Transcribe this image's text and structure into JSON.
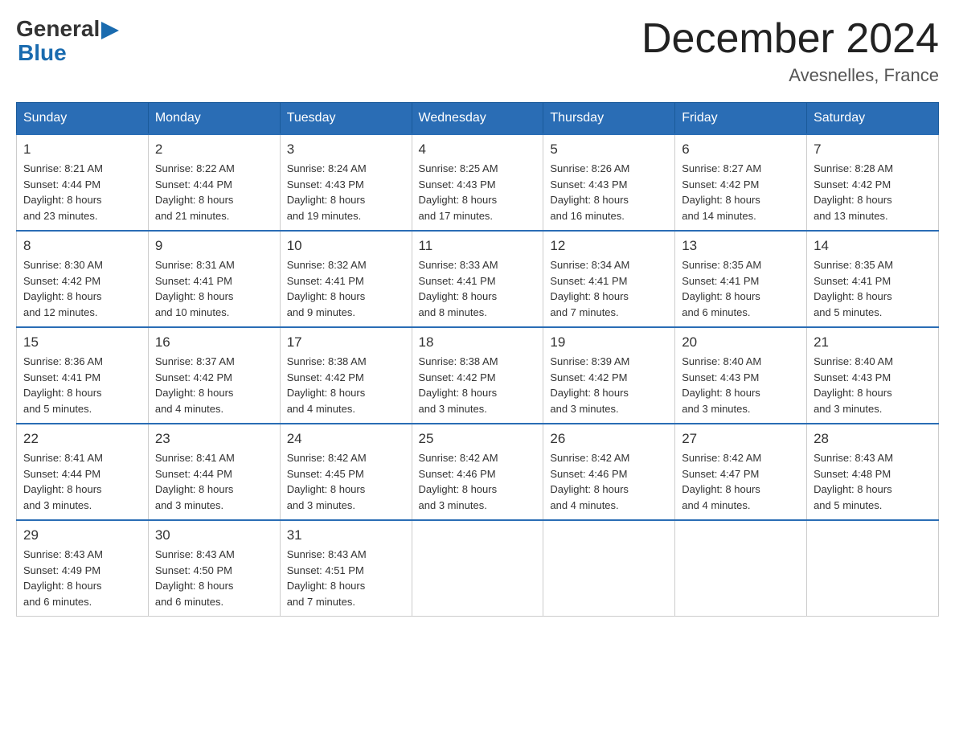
{
  "header": {
    "logo": {
      "general": "General",
      "blue": "Blue",
      "triangle": "▶"
    },
    "title": "December 2024",
    "location": "Avesnelles, France"
  },
  "weekdays": [
    "Sunday",
    "Monday",
    "Tuesday",
    "Wednesday",
    "Thursday",
    "Friday",
    "Saturday"
  ],
  "weeks": [
    [
      {
        "day": "1",
        "sunrise": "Sunrise: 8:21 AM",
        "sunset": "Sunset: 4:44 PM",
        "daylight": "Daylight: 8 hours",
        "minutes": "and 23 minutes."
      },
      {
        "day": "2",
        "sunrise": "Sunrise: 8:22 AM",
        "sunset": "Sunset: 4:44 PM",
        "daylight": "Daylight: 8 hours",
        "minutes": "and 21 minutes."
      },
      {
        "day": "3",
        "sunrise": "Sunrise: 8:24 AM",
        "sunset": "Sunset: 4:43 PM",
        "daylight": "Daylight: 8 hours",
        "minutes": "and 19 minutes."
      },
      {
        "day": "4",
        "sunrise": "Sunrise: 8:25 AM",
        "sunset": "Sunset: 4:43 PM",
        "daylight": "Daylight: 8 hours",
        "minutes": "and 17 minutes."
      },
      {
        "day": "5",
        "sunrise": "Sunrise: 8:26 AM",
        "sunset": "Sunset: 4:43 PM",
        "daylight": "Daylight: 8 hours",
        "minutes": "and 16 minutes."
      },
      {
        "day": "6",
        "sunrise": "Sunrise: 8:27 AM",
        "sunset": "Sunset: 4:42 PM",
        "daylight": "Daylight: 8 hours",
        "minutes": "and 14 minutes."
      },
      {
        "day": "7",
        "sunrise": "Sunrise: 8:28 AM",
        "sunset": "Sunset: 4:42 PM",
        "daylight": "Daylight: 8 hours",
        "minutes": "and 13 minutes."
      }
    ],
    [
      {
        "day": "8",
        "sunrise": "Sunrise: 8:30 AM",
        "sunset": "Sunset: 4:42 PM",
        "daylight": "Daylight: 8 hours",
        "minutes": "and 12 minutes."
      },
      {
        "day": "9",
        "sunrise": "Sunrise: 8:31 AM",
        "sunset": "Sunset: 4:41 PM",
        "daylight": "Daylight: 8 hours",
        "minutes": "and 10 minutes."
      },
      {
        "day": "10",
        "sunrise": "Sunrise: 8:32 AM",
        "sunset": "Sunset: 4:41 PM",
        "daylight": "Daylight: 8 hours",
        "minutes": "and 9 minutes."
      },
      {
        "day": "11",
        "sunrise": "Sunrise: 8:33 AM",
        "sunset": "Sunset: 4:41 PM",
        "daylight": "Daylight: 8 hours",
        "minutes": "and 8 minutes."
      },
      {
        "day": "12",
        "sunrise": "Sunrise: 8:34 AM",
        "sunset": "Sunset: 4:41 PM",
        "daylight": "Daylight: 8 hours",
        "minutes": "and 7 minutes."
      },
      {
        "day": "13",
        "sunrise": "Sunrise: 8:35 AM",
        "sunset": "Sunset: 4:41 PM",
        "daylight": "Daylight: 8 hours",
        "minutes": "and 6 minutes."
      },
      {
        "day": "14",
        "sunrise": "Sunrise: 8:35 AM",
        "sunset": "Sunset: 4:41 PM",
        "daylight": "Daylight: 8 hours",
        "minutes": "and 5 minutes."
      }
    ],
    [
      {
        "day": "15",
        "sunrise": "Sunrise: 8:36 AM",
        "sunset": "Sunset: 4:41 PM",
        "daylight": "Daylight: 8 hours",
        "minutes": "and 5 minutes."
      },
      {
        "day": "16",
        "sunrise": "Sunrise: 8:37 AM",
        "sunset": "Sunset: 4:42 PM",
        "daylight": "Daylight: 8 hours",
        "minutes": "and 4 minutes."
      },
      {
        "day": "17",
        "sunrise": "Sunrise: 8:38 AM",
        "sunset": "Sunset: 4:42 PM",
        "daylight": "Daylight: 8 hours",
        "minutes": "and 4 minutes."
      },
      {
        "day": "18",
        "sunrise": "Sunrise: 8:38 AM",
        "sunset": "Sunset: 4:42 PM",
        "daylight": "Daylight: 8 hours",
        "minutes": "and 3 minutes."
      },
      {
        "day": "19",
        "sunrise": "Sunrise: 8:39 AM",
        "sunset": "Sunset: 4:42 PM",
        "daylight": "Daylight: 8 hours",
        "minutes": "and 3 minutes."
      },
      {
        "day": "20",
        "sunrise": "Sunrise: 8:40 AM",
        "sunset": "Sunset: 4:43 PM",
        "daylight": "Daylight: 8 hours",
        "minutes": "and 3 minutes."
      },
      {
        "day": "21",
        "sunrise": "Sunrise: 8:40 AM",
        "sunset": "Sunset: 4:43 PM",
        "daylight": "Daylight: 8 hours",
        "minutes": "and 3 minutes."
      }
    ],
    [
      {
        "day": "22",
        "sunrise": "Sunrise: 8:41 AM",
        "sunset": "Sunset: 4:44 PM",
        "daylight": "Daylight: 8 hours",
        "minutes": "and 3 minutes."
      },
      {
        "day": "23",
        "sunrise": "Sunrise: 8:41 AM",
        "sunset": "Sunset: 4:44 PM",
        "daylight": "Daylight: 8 hours",
        "minutes": "and 3 minutes."
      },
      {
        "day": "24",
        "sunrise": "Sunrise: 8:42 AM",
        "sunset": "Sunset: 4:45 PM",
        "daylight": "Daylight: 8 hours",
        "minutes": "and 3 minutes."
      },
      {
        "day": "25",
        "sunrise": "Sunrise: 8:42 AM",
        "sunset": "Sunset: 4:46 PM",
        "daylight": "Daylight: 8 hours",
        "minutes": "and 3 minutes."
      },
      {
        "day": "26",
        "sunrise": "Sunrise: 8:42 AM",
        "sunset": "Sunset: 4:46 PM",
        "daylight": "Daylight: 8 hours",
        "minutes": "and 4 minutes."
      },
      {
        "day": "27",
        "sunrise": "Sunrise: 8:42 AM",
        "sunset": "Sunset: 4:47 PM",
        "daylight": "Daylight: 8 hours",
        "minutes": "and 4 minutes."
      },
      {
        "day": "28",
        "sunrise": "Sunrise: 8:43 AM",
        "sunset": "Sunset: 4:48 PM",
        "daylight": "Daylight: 8 hours",
        "minutes": "and 5 minutes."
      }
    ],
    [
      {
        "day": "29",
        "sunrise": "Sunrise: 8:43 AM",
        "sunset": "Sunset: 4:49 PM",
        "daylight": "Daylight: 8 hours",
        "minutes": "and 6 minutes."
      },
      {
        "day": "30",
        "sunrise": "Sunrise: 8:43 AM",
        "sunset": "Sunset: 4:50 PM",
        "daylight": "Daylight: 8 hours",
        "minutes": "and 6 minutes."
      },
      {
        "day": "31",
        "sunrise": "Sunrise: 8:43 AM",
        "sunset": "Sunset: 4:51 PM",
        "daylight": "Daylight: 8 hours",
        "minutes": "and 7 minutes."
      },
      null,
      null,
      null,
      null
    ]
  ]
}
